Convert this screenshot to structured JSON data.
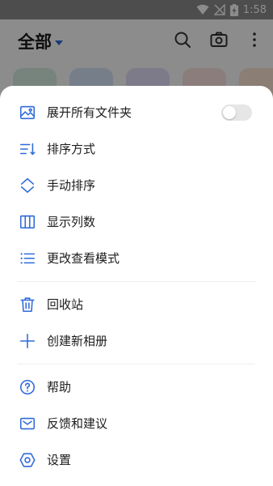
{
  "status_bar": {
    "time": "1:58"
  },
  "header": {
    "title": "全部"
  },
  "menu": {
    "expand_folders": {
      "label": "展开所有文件夹",
      "enabled": false
    },
    "sort_method": "排序方式",
    "manual_sort": "手动排序",
    "columns": "显示列数",
    "view_mode": "更改查看模式",
    "recycle_bin": "回收站",
    "new_album": "创建新相册",
    "help": "帮助",
    "feedback": "反馈和建议",
    "settings": "设置"
  },
  "colors": {
    "accent": "#2f6bd9"
  }
}
